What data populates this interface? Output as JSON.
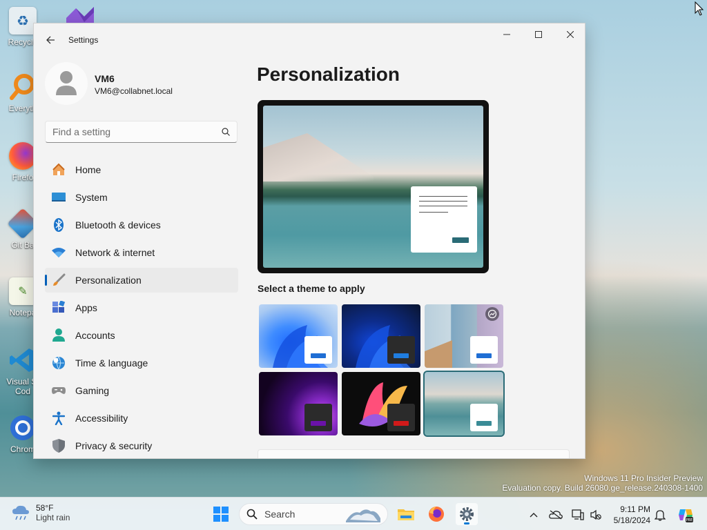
{
  "desktop": {
    "icons": [
      {
        "label": "Recycle",
        "icon": "recycle-bin-icon"
      },
      {
        "label": "Everyth",
        "icon": "everything-search-icon"
      },
      {
        "label": "Firefo",
        "icon": "firefox-icon"
      },
      {
        "label": "Git Ba",
        "icon": "git-bash-icon"
      },
      {
        "label": "Notepa",
        "icon": "notepad-plus-plus-icon"
      },
      {
        "label": "Visual St\nCod",
        "icon": "vscode-icon"
      },
      {
        "label": "Chrom",
        "icon": "chrome-icon"
      }
    ],
    "watermark": {
      "line1": "Windows 11 Pro Insider Preview",
      "line2": "Evaluation copy. Build 26080.ge_release.240308-1400"
    }
  },
  "window": {
    "title": "Settings",
    "user": {
      "name": "VM6",
      "email": "VM6@collabnet.local"
    },
    "search": {
      "placeholder": "Find a setting",
      "value": ""
    },
    "nav": [
      {
        "label": "Home",
        "icon": "home-icon",
        "active": false
      },
      {
        "label": "System",
        "icon": "system-display-icon",
        "active": false
      },
      {
        "label": "Bluetooth & devices",
        "icon": "bluetooth-icon",
        "active": false
      },
      {
        "label": "Network & internet",
        "icon": "wifi-icon",
        "active": false
      },
      {
        "label": "Personalization",
        "icon": "paintbrush-icon",
        "active": true
      },
      {
        "label": "Apps",
        "icon": "apps-icon",
        "active": false
      },
      {
        "label": "Accounts",
        "icon": "account-icon",
        "active": false
      },
      {
        "label": "Time & language",
        "icon": "globe-clock-icon",
        "active": false
      },
      {
        "label": "Gaming",
        "icon": "gamepad-icon",
        "active": false
      },
      {
        "label": "Accessibility",
        "icon": "accessibility-icon",
        "active": false
      },
      {
        "label": "Privacy & security",
        "icon": "shield-icon",
        "active": false
      }
    ],
    "page_title": "Personalization",
    "theme_heading": "Select a theme to apply",
    "themes": [
      {
        "name": "windows-light",
        "selected": false
      },
      {
        "name": "windows-dark",
        "selected": false
      },
      {
        "name": "spotlight",
        "selected": false
      },
      {
        "name": "glow",
        "selected": false
      },
      {
        "name": "captured-motion",
        "selected": false
      },
      {
        "name": "sunrise-lake",
        "selected": true
      }
    ],
    "accent_color": "#005fb8"
  },
  "taskbar": {
    "weather": {
      "temp": "58°F",
      "condition": "Light rain"
    },
    "search_label": "Search",
    "time": "9:11 PM",
    "date": "5/18/2024"
  }
}
